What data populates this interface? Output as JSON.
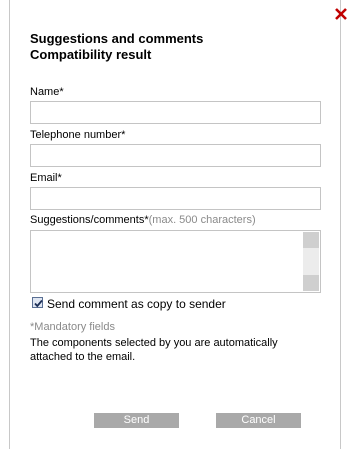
{
  "header": {
    "title": "Suggestions and comments",
    "subtitle": "Compatibility result"
  },
  "form": {
    "name_label": "Name*",
    "name_value": "",
    "phone_label": "Telephone number*",
    "phone_value": "",
    "email_label": "Email*",
    "email_value": "",
    "comments_label": "Suggestions/comments*",
    "comments_hint": "(max. 500 characters)",
    "comments_value": "",
    "copy_checkbox_label": "Send comment as copy to sender",
    "copy_checkbox_checked": true,
    "mandatory_note": "*Mandatory fields",
    "info_text": "The components selected by you are automatically attached to the email."
  },
  "buttons": {
    "send": "Send",
    "cancel": "Cancel"
  },
  "colors": {
    "close_icon": "#c00000",
    "button_bg": "#a9a9a9",
    "hint_text": "#8a8a8a"
  },
  "icons": {
    "close": "close-icon",
    "checkbox": "checkmark-icon"
  }
}
